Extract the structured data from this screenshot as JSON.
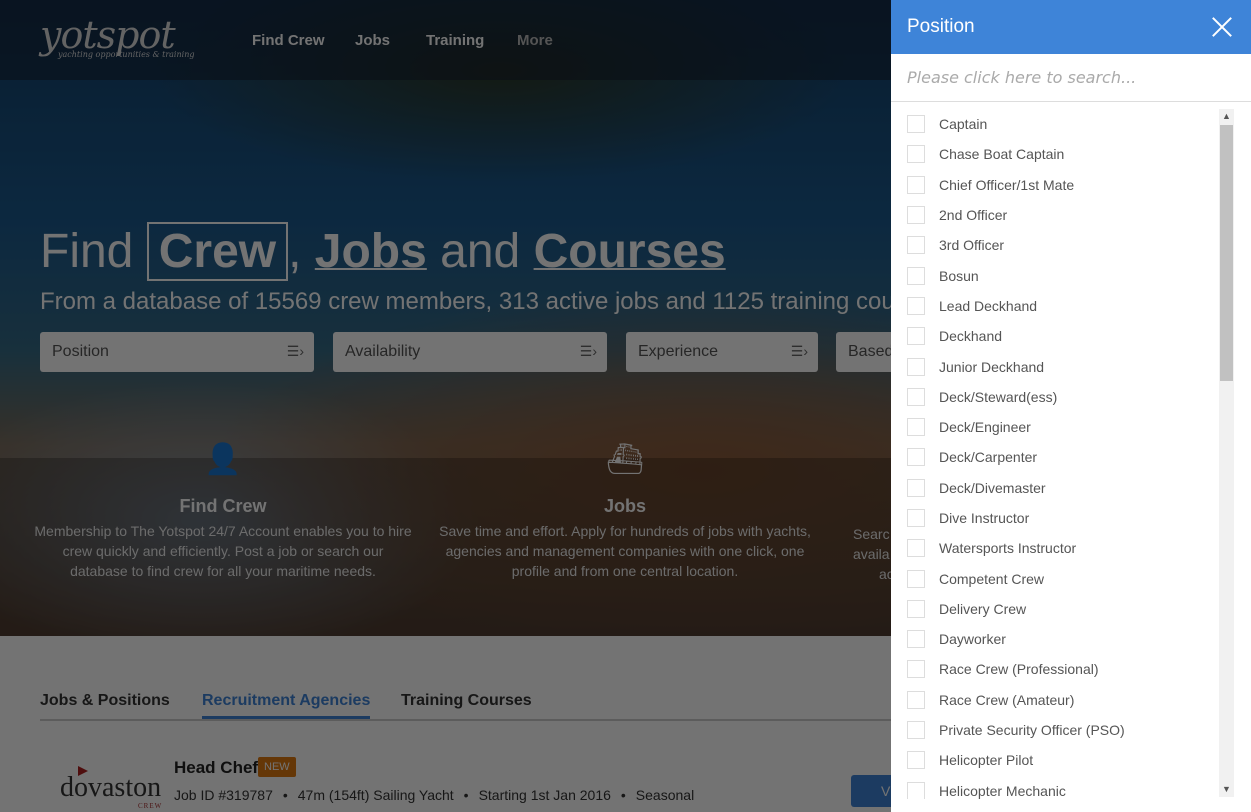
{
  "nav": {
    "logo": "yotspot",
    "logo_tagline": "yachting opportunities & training",
    "links": [
      "Find Crew",
      "Jobs",
      "Training",
      "More"
    ]
  },
  "hero": {
    "title_find": "Find",
    "title_crew": "Crew",
    "title_comma": ",",
    "title_jobs": "Jobs",
    "title_and": "and",
    "title_courses": "Courses",
    "subtitle": "From a database of 15569 crew members, 313 active jobs and 1125 training cour",
    "filters": [
      "Position",
      "Availability",
      "Experience",
      "Based"
    ]
  },
  "features": [
    {
      "icon": "user-icon",
      "title": "Find Crew",
      "text": "Membership to The Yotspot 24/7 Account enables you to hire crew quickly and efficiently. Post a job or search our database to find crew for all your maritime needs."
    },
    {
      "icon": "ship-icon",
      "title": "Jobs",
      "text": "Save time and effort. Apply for hundreds of jobs with yachts, agencies and management companies with one click, one profile and from one central location."
    },
    {
      "lines": [
        "Searc",
        "availa",
        "ac"
      ]
    }
  ],
  "tabs": [
    "Jobs & Positions",
    "Recruitment Agencies",
    "Training Courses"
  ],
  "active_tab": 1,
  "job": {
    "logo": "dovaston",
    "logo_sub": "CREW",
    "title": "Head Chef",
    "badge": "NEW",
    "job_id": "Job ID #319787",
    "vessel": "47m (154ft) Sailing Yacht",
    "start": "Starting 1st Jan 2016",
    "type": "Seasonal",
    "button": "V"
  },
  "panel": {
    "title": "Position",
    "search_placeholder": "Please click here to search...",
    "items": [
      "Captain",
      "Chase Boat Captain",
      "Chief Officer/1st Mate",
      "2nd Officer",
      "3rd Officer",
      "Bosun",
      "Lead Deckhand",
      "Deckhand",
      "Junior Deckhand",
      "Deck/Steward(ess)",
      "Deck/Engineer",
      "Deck/Carpenter",
      "Deck/Divemaster",
      "Dive Instructor",
      "Watersports Instructor",
      "Competent Crew",
      "Delivery Crew",
      "Dayworker",
      "Race Crew (Professional)",
      "Race Crew (Amateur)",
      "Private Security Officer (PSO)",
      "Helicopter Pilot",
      "Helicopter Mechanic"
    ]
  },
  "colors": {
    "accent": "#3e84d8",
    "badge": "#e07a10"
  }
}
